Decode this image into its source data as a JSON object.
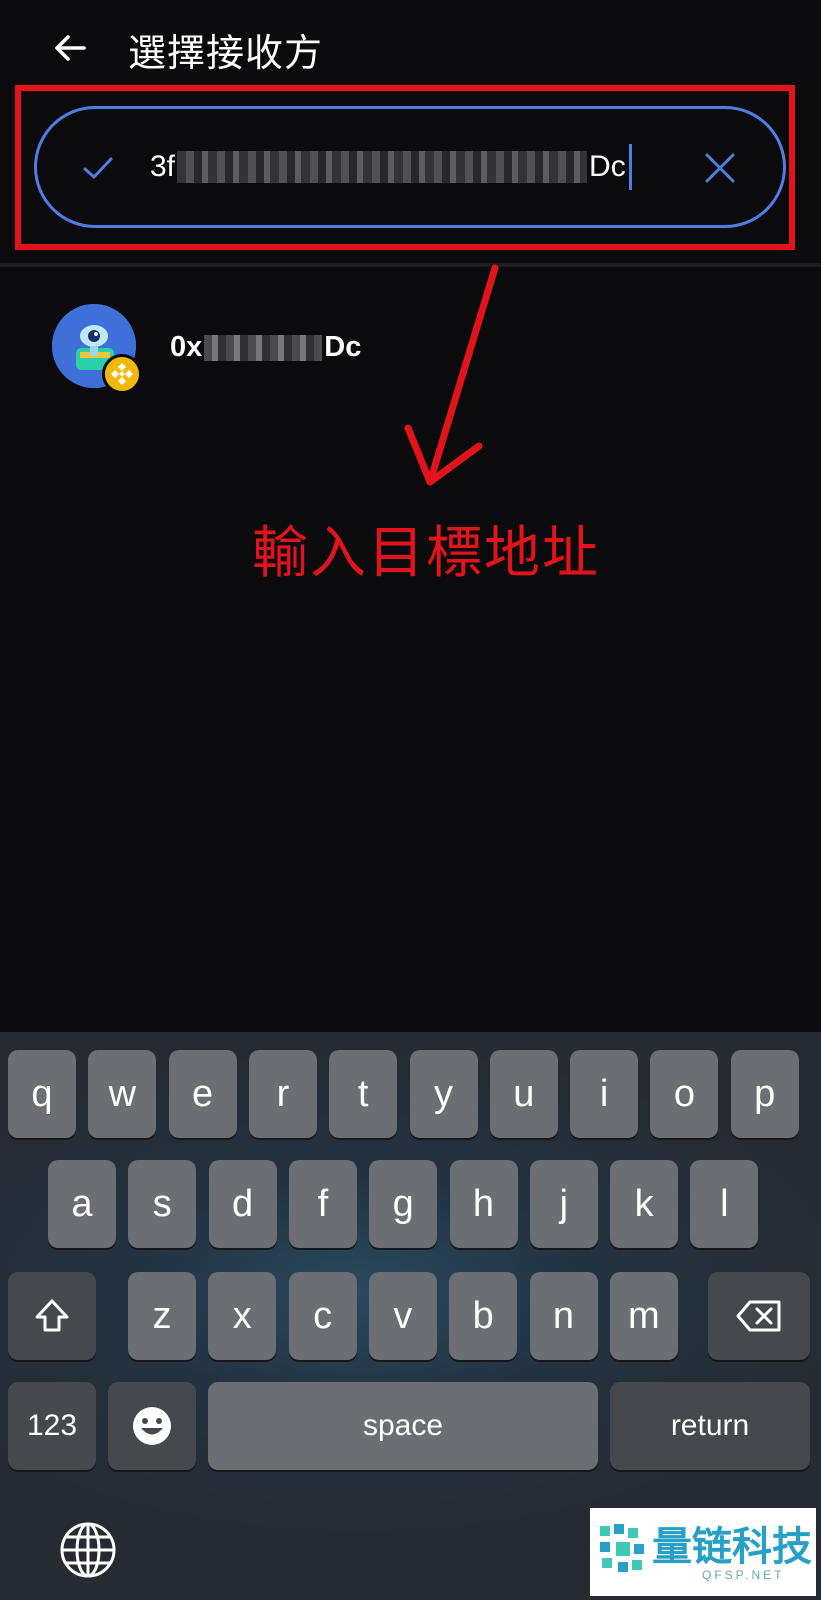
{
  "header": {
    "title": "選擇接收方"
  },
  "search": {
    "address_start": "3f",
    "address_end": "Dc"
  },
  "result": {
    "address_start": "0x",
    "address_end": "Dc"
  },
  "annotation": {
    "text": "輸入目標地址",
    "color": "#e3131b"
  },
  "keyboard": {
    "row1": [
      "q",
      "w",
      "e",
      "r",
      "t",
      "y",
      "u",
      "i",
      "o",
      "p"
    ],
    "row2": [
      "a",
      "s",
      "d",
      "f",
      "g",
      "h",
      "j",
      "k",
      "l"
    ],
    "row3": [
      "z",
      "x",
      "c",
      "v",
      "b",
      "n",
      "m"
    ],
    "numbers_label": "123",
    "space_label": "space",
    "return_label": "return"
  },
  "watermark": {
    "text": "量链科技",
    "sub": "QFSP.NET"
  },
  "colors": {
    "accent": "#4d7ee0",
    "background": "#0b0b0e",
    "highlight": "#e3131b"
  }
}
